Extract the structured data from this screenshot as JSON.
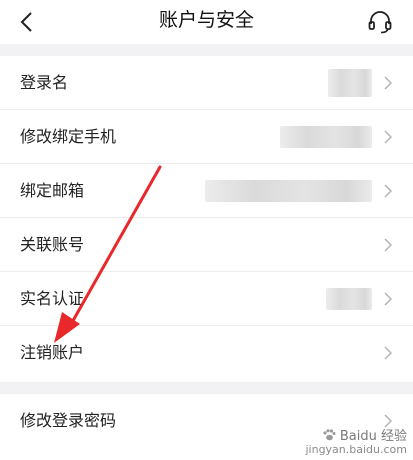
{
  "header": {
    "title": "账户与安全",
    "back_icon": "chevron-left-icon",
    "service_icon": "headset-icon"
  },
  "rows_group1": [
    {
      "label": "登录名"
    },
    {
      "label": "修改绑定手机"
    },
    {
      "label": "绑定邮箱"
    },
    {
      "label": "关联账号"
    },
    {
      "label": "实名认证"
    },
    {
      "label": "注销账户"
    }
  ],
  "rows_group2": [
    {
      "label": "修改登录密码"
    }
  ],
  "watermark": {
    "main": "Baidu 经验",
    "sub": "jingyan.baidu.com"
  },
  "colors": {
    "background": "#f2f2f4",
    "card": "#ffffff",
    "arrow": "#e8282b",
    "chevron": "#b5b5b5"
  }
}
